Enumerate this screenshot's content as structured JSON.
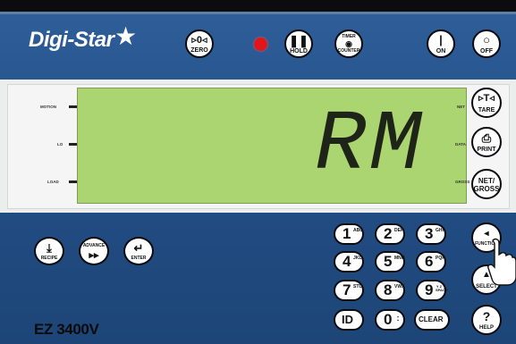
{
  "brand": {
    "name": "Digi-Star",
    "star": "★"
  },
  "model": "EZ 3400V",
  "display": {
    "readout": "RM"
  },
  "indicators": {
    "left": [
      "MOTION",
      "LO",
      "LOAD"
    ],
    "right": [
      "NET",
      "DATA",
      "GROSS"
    ]
  },
  "top_keys": {
    "zero": "ZERO",
    "hold": "HOLD",
    "timer_top": "TIMER",
    "timer_bottom": "COUNTER",
    "on": "ON",
    "off": "OFF"
  },
  "right_keys": {
    "tare": "TARE",
    "print": "PRINT",
    "net_gross_top": "NET/",
    "net_gross_bottom": "GROSS"
  },
  "bottom_left_keys": {
    "recipe": "RECIPE",
    "advance": "ADVANCE",
    "enter": "ENTER"
  },
  "keypad": [
    {
      "digit": "1",
      "sub": "ABC"
    },
    {
      "digit": "2",
      "sub": "DEF"
    },
    {
      "digit": "3",
      "sub": "GHI"
    },
    {
      "digit": "4",
      "sub": "JKL"
    },
    {
      "digit": "5",
      "sub": "MNO"
    },
    {
      "digit": "6",
      "sub": "PQR"
    },
    {
      "digit": "7",
      "sub": "STU"
    },
    {
      "digit": "8",
      "sub": "VWX"
    },
    {
      "digit": "9",
      "sub": "Y Z SPACE"
    },
    {
      "digit": "ID",
      "sub": ""
    },
    {
      "digit": "0",
      "sub": ":"
    },
    {
      "digit": "CLEAR",
      "sub": ""
    }
  ],
  "side_keys": {
    "function": "FUNCTION",
    "select": "SELECT",
    "help": "HELP"
  },
  "colors": {
    "body": "#2a5891",
    "lcd": "#abd570",
    "led": "#e0161b",
    "topbar": "#0c0c10"
  }
}
